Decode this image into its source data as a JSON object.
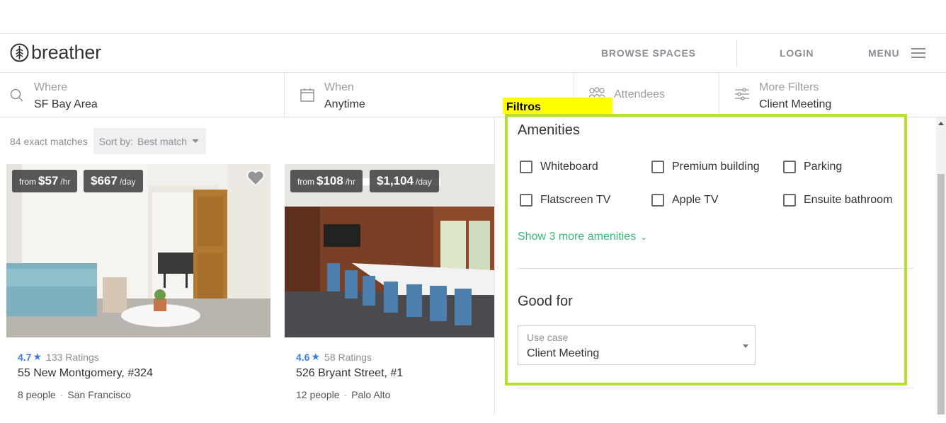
{
  "header": {
    "logo_text": "breather",
    "nav": {
      "browse": "BROWSE SPACES",
      "login": "LOGIN",
      "menu": "MENU"
    }
  },
  "search": {
    "where": {
      "label": "Where",
      "value": "SF Bay Area"
    },
    "when": {
      "label": "When",
      "value": "Anytime"
    },
    "attendees": {
      "label": "Attendees"
    },
    "more_filters": {
      "label": "More Filters",
      "value": "Client Meeting"
    }
  },
  "results": {
    "count_text": "84 exact matches",
    "sort_label": "Sort by:",
    "sort_value": "Best match"
  },
  "listings": [
    {
      "price_from_prefix": "from",
      "price_hour": "$57",
      "price_hour_unit": "/hr",
      "price_day": "$667",
      "price_day_unit": "/day",
      "rating": "4.7",
      "ratings_count": "133 Ratings",
      "address": "55 New Montgomery, #324",
      "people": "8 people",
      "city": "San Francisco"
    },
    {
      "price_from_prefix": "from",
      "price_hour": "$108",
      "price_hour_unit": "/hr",
      "price_day": "$1,104",
      "price_day_unit": "/day",
      "rating": "4.6",
      "ratings_count": "58 Ratings",
      "address": "526 Bryant Street, #1",
      "people": "12 people",
      "city": "Palo Alto"
    }
  ],
  "annotation": {
    "tag": "Filtros",
    "highlight_color": "#b5e02f",
    "tag_color": "#ffff00"
  },
  "filters": {
    "amenities_title": "Amenities",
    "amenities": [
      "Whiteboard",
      "Premium building",
      "Parking",
      "Flatscreen TV",
      "Apple TV",
      "Ensuite bathroom"
    ],
    "show_more": "Show 3 more amenities",
    "good_for_title": "Good for",
    "use_case_label": "Use case",
    "use_case_value": "Client Meeting"
  },
  "colors": {
    "accent_green": "#3cb77a",
    "rating_blue": "#3b7dd8"
  }
}
